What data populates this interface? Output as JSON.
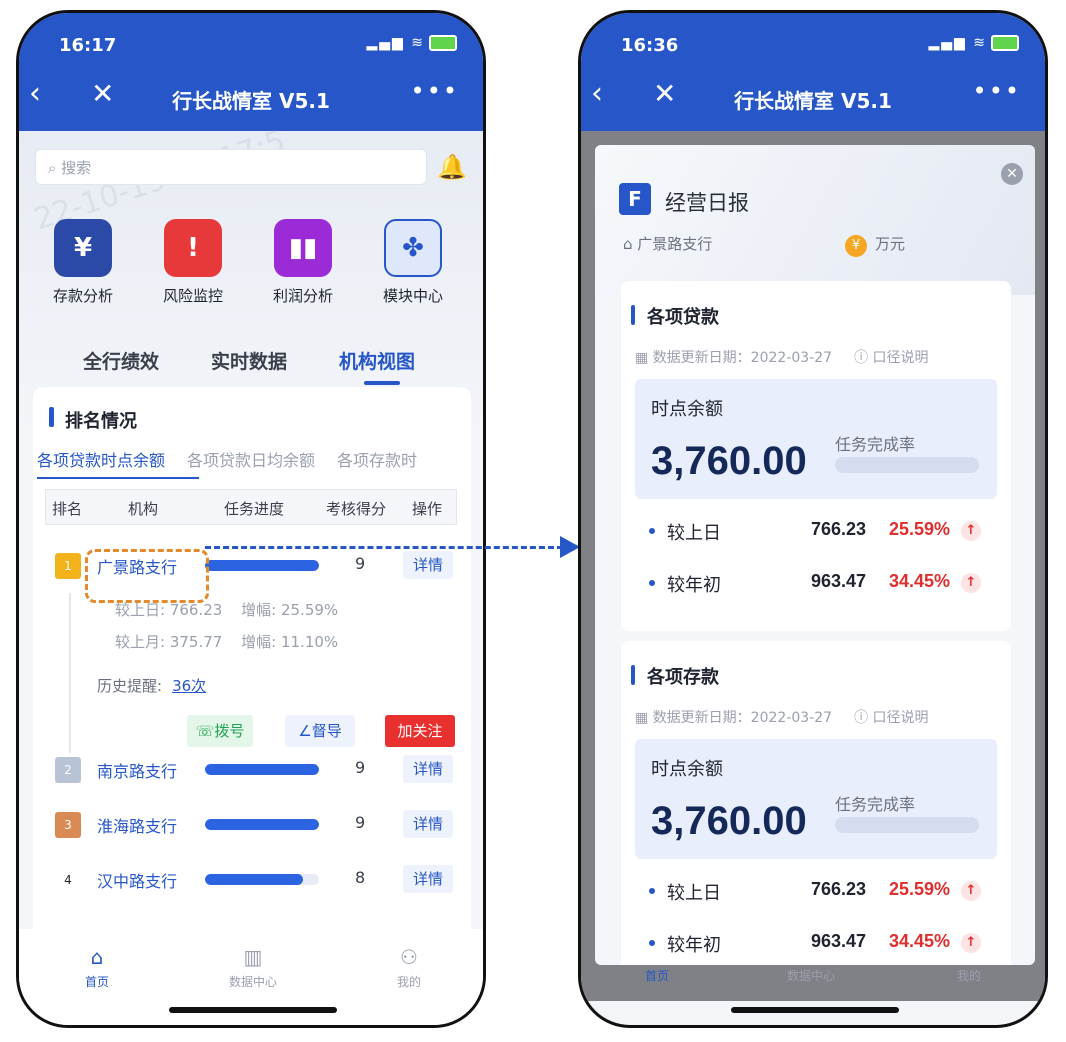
{
  "app": {
    "title": "行长战情室 V5.1",
    "back_icon": "chevron-left-icon",
    "close_icon": "close-icon",
    "more_icon": "more-dots-icon"
  },
  "phone1": {
    "status_time": "16:17",
    "watermark": "22-10-19 16:17:5",
    "search_placeholder": "搜索",
    "quick_actions": [
      {
        "label": "存款分析",
        "icon": "money-bag-icon",
        "color": "#2b4aa8",
        "glyph": "¥"
      },
      {
        "label": "风险监控",
        "icon": "alarm-icon",
        "color": "#e8393a",
        "glyph": "!"
      },
      {
        "label": "利润分析",
        "icon": "bar-chart-icon",
        "color": "#9b2bd6",
        "glyph": "▮"
      },
      {
        "label": "模块中心",
        "icon": "grid-icon",
        "color": "#2656c8",
        "glyph": "✤"
      }
    ],
    "tabs": [
      "全行绩效",
      "实时数据",
      "机构视图"
    ],
    "active_tab": "机构视图",
    "section_title": "排名情况",
    "sub_tabs": [
      "各项贷款时点余额",
      "各项贷款日均余额",
      "各项存款时"
    ],
    "table_headers": [
      "排名",
      "机构",
      "任务进度",
      "考核得分",
      "操作"
    ],
    "rows": [
      {
        "rank": "1",
        "name": "广景路支行",
        "progress": 1.0,
        "score": "9",
        "action": "详情",
        "rank_color": "#f4b21a"
      },
      {
        "rank": "2",
        "name": "南京路支行",
        "progress": 1.0,
        "score": "9",
        "action": "详情",
        "rank_color": "#b9c3d6"
      },
      {
        "rank": "3",
        "name": "淮海路支行",
        "progress": 1.0,
        "score": "9",
        "action": "详情",
        "rank_color": "#d98a55"
      },
      {
        "rank": "4",
        "name": "汉中路支行",
        "progress": 0.86,
        "score": "8",
        "action": "详情",
        "rank_color": "#ffffff"
      }
    ],
    "expanded": {
      "day_label": "较上日:",
      "day_value": "766.23",
      "day_inc_label": "增幅:",
      "day_inc_value": "25.59%",
      "month_label": "较上月:",
      "month_value": "375.77",
      "month_inc_label": "增幅:",
      "month_inc_value": "11.10%",
      "history_label": "历史提醒:",
      "history_value": "36次",
      "btn_call": "拨号",
      "btn_supervise": "督导",
      "btn_follow": "加关注"
    },
    "tabbar": [
      {
        "label": "首页",
        "icon": "home-icon"
      },
      {
        "label": "数据中心",
        "icon": "chart-icon"
      },
      {
        "label": "我的",
        "icon": "user-icon"
      }
    ]
  },
  "phone2": {
    "status_time": "16:36",
    "modal_title": "经营日报",
    "branch": "广景路支行",
    "unit": "万元",
    "sections": [
      {
        "title": "各项贷款",
        "date_label": "数据更新日期：2022-03-27",
        "note": "口径说明",
        "balance_label": "时点余额",
        "balance_value": "3,760.00",
        "rate_label": "任务完成率",
        "lines": [
          {
            "name": "较上日",
            "value": "766.23",
            "pct": "25.59%"
          },
          {
            "name": "较年初",
            "value": "963.47",
            "pct": "34.45%"
          }
        ]
      },
      {
        "title": "各项存款",
        "date_label": "数据更新日期：2022-03-27",
        "note": "口径说明",
        "balance_label": "时点余额",
        "balance_value": "3,760.00",
        "rate_label": "任务完成率",
        "lines": [
          {
            "name": "较上日",
            "value": "766.23",
            "pct": "25.59%"
          },
          {
            "name": "较年初",
            "value": "963.47",
            "pct": "34.45%"
          }
        ]
      }
    ],
    "tabbar": [
      "首页",
      "数据中心",
      "我的"
    ]
  }
}
